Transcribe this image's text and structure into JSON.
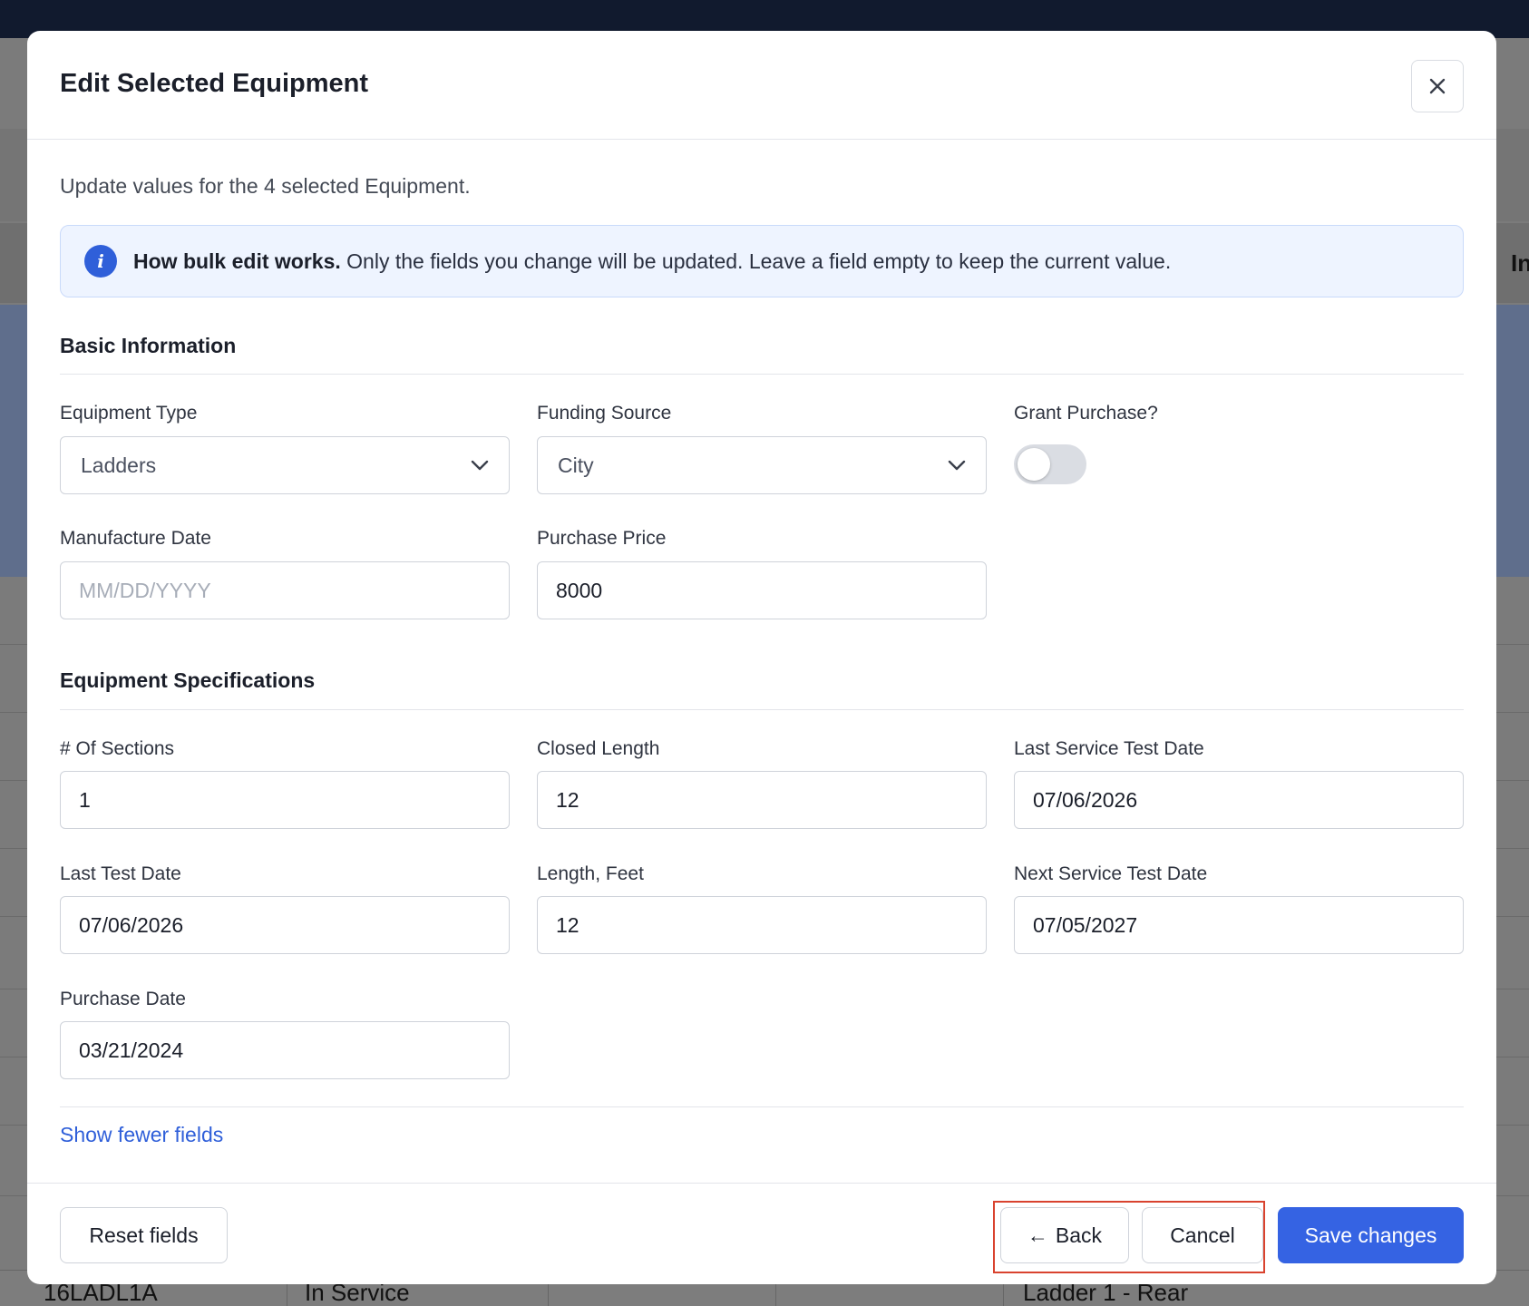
{
  "background": {
    "row_cells": [
      "16LADL1A",
      "In Service",
      "Ladder 1 - Rear"
    ],
    "partial_header": "In"
  },
  "modal": {
    "title": "Edit Selected Equipment",
    "close_icon": "close-icon",
    "intro": "Update values for the 4 selected Equipment.",
    "info": {
      "icon": "info-icon",
      "icon_glyph": "i",
      "bold": "How bulk edit works.",
      "text": " Only the fields you change will be updated. Leave a field empty to keep the current value."
    },
    "basic": {
      "title": "Basic Information",
      "equipment_type": {
        "label": "Equipment Type",
        "value": "Ladders"
      },
      "funding_source": {
        "label": "Funding Source",
        "value": "City"
      },
      "grant_purchase": {
        "label": "Grant Purchase?",
        "checked": false
      },
      "manufacture_date": {
        "label": "Manufacture Date",
        "value": "",
        "placeholder": "MM/DD/YYYY"
      },
      "purchase_price": {
        "label": "Purchase Price",
        "value": "8000"
      }
    },
    "specs": {
      "title": "Equipment Specifications",
      "sections": {
        "label": "# Of Sections",
        "value": "1"
      },
      "closed_length": {
        "label": "Closed Length",
        "value": "12"
      },
      "last_service_test_date": {
        "label": "Last Service Test Date",
        "value": "07/06/2026"
      },
      "last_test_date": {
        "label": "Last Test Date",
        "value": "07/06/2026"
      },
      "length_feet": {
        "label": "Length, Feet",
        "value": "12"
      },
      "next_service_test_date": {
        "label": "Next Service Test Date",
        "value": "07/05/2027"
      },
      "purchase_date": {
        "label": "Purchase Date",
        "value": "03/21/2024"
      }
    },
    "show_fewer": "Show fewer fields",
    "footer": {
      "reset": "Reset fields",
      "back": "Back",
      "back_icon": "arrow-left-icon",
      "back_glyph": "←",
      "cancel": "Cancel",
      "save": "Save changes"
    }
  },
  "colors": {
    "primary": "#3563e3",
    "link": "#2f5fd9",
    "highlight": "#d9432f",
    "topbar": "#111a2e"
  }
}
